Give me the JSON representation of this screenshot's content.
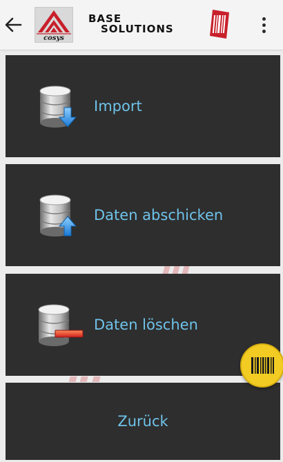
{
  "header": {
    "brand_line1": "BASE",
    "brand_line2": "SOLUTIONS",
    "back_icon": "arrow-left-icon",
    "menu_icon": "more-vert-icon",
    "logo_icon": "cosys-logo",
    "scanner_icon": "barcode-scanner-icon"
  },
  "menu": [
    {
      "label": "Import",
      "icon": "database-download-icon"
    },
    {
      "label": "Daten abschicken",
      "icon": "database-upload-icon"
    },
    {
      "label": "Daten löschen",
      "icon": "database-delete-icon"
    },
    {
      "label": "Zurück"
    }
  ],
  "fab": {
    "icon": "barcode-icon"
  },
  "colors": {
    "tile_bg": "#2e2e2e",
    "label": "#6fc3ea",
    "fab": "#f2cc22",
    "brand_red": "#c8202b"
  }
}
